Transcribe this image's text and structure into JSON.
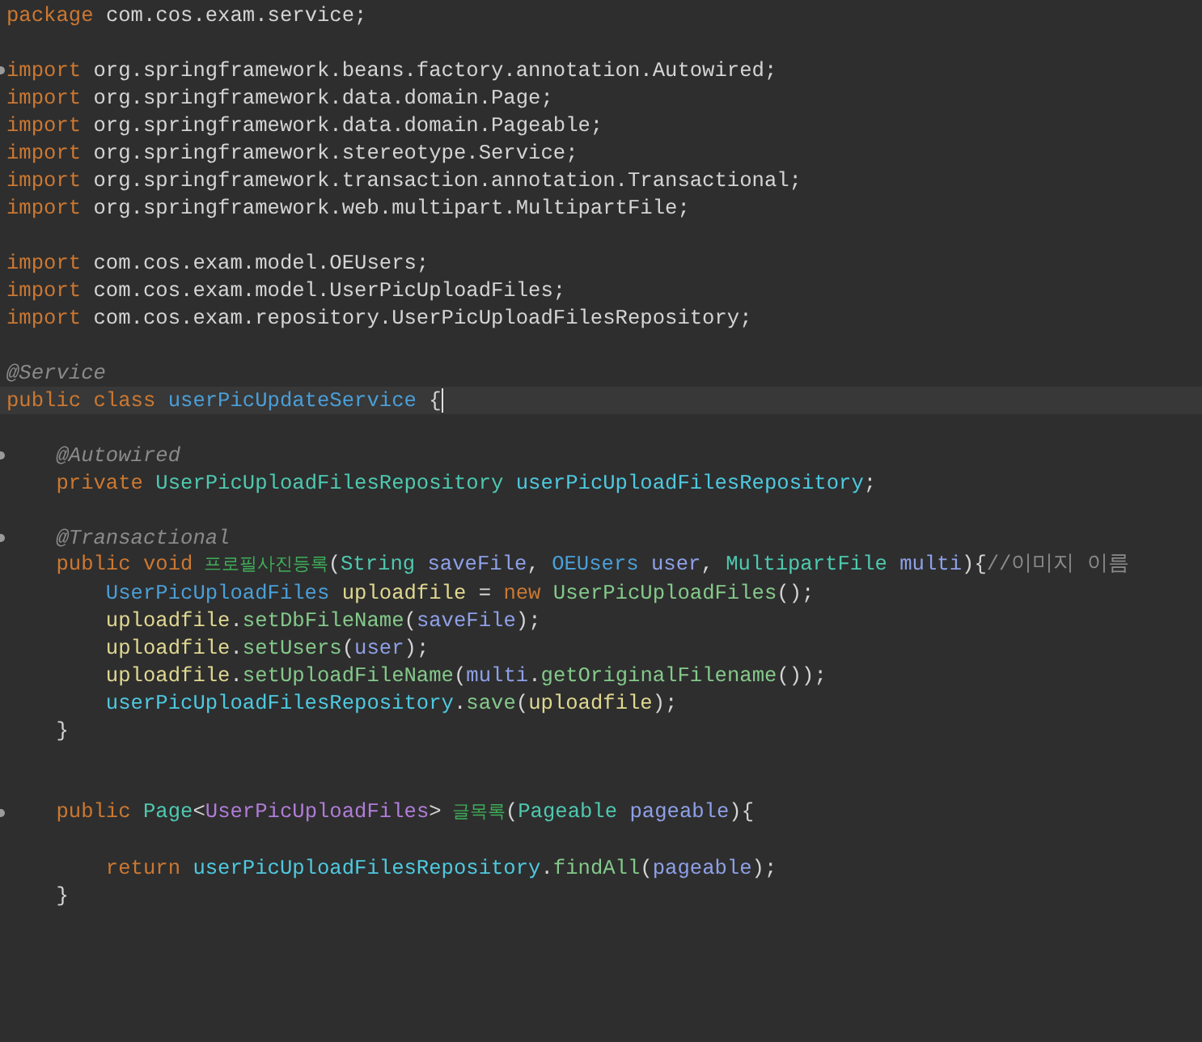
{
  "editor": {
    "lines": [
      {
        "kind": "code",
        "tokens": [
          {
            "kind": "keyword",
            "text": "package"
          },
          {
            "kind": "plain",
            "text": " com.cos.exam.service;"
          }
        ]
      },
      {
        "kind": "blank"
      },
      {
        "kind": "code",
        "marker": true,
        "tokens": [
          {
            "kind": "keyword",
            "text": "import"
          },
          {
            "kind": "plain",
            "text": " org.springframework.beans.factory.annotation.Autowired;"
          }
        ]
      },
      {
        "kind": "code",
        "tokens": [
          {
            "kind": "keyword",
            "text": "import"
          },
          {
            "kind": "plain",
            "text": " org.springframework.data.domain.Page;"
          }
        ]
      },
      {
        "kind": "code",
        "tokens": [
          {
            "kind": "keyword",
            "text": "import"
          },
          {
            "kind": "plain",
            "text": " org.springframework.data.domain.Pageable;"
          }
        ]
      },
      {
        "kind": "code",
        "tokens": [
          {
            "kind": "keyword",
            "text": "import"
          },
          {
            "kind": "plain",
            "text": " org.springframework.stereotype.Service;"
          }
        ]
      },
      {
        "kind": "code",
        "tokens": [
          {
            "kind": "keyword",
            "text": "import"
          },
          {
            "kind": "plain",
            "text": " org.springframework.transaction.annotation.Transactional;"
          }
        ]
      },
      {
        "kind": "code",
        "tokens": [
          {
            "kind": "keyword",
            "text": "import"
          },
          {
            "kind": "plain",
            "text": " org.springframework.web.multipart.MultipartFile;"
          }
        ]
      },
      {
        "kind": "blank"
      },
      {
        "kind": "code",
        "tokens": [
          {
            "kind": "keyword",
            "text": "import"
          },
          {
            "kind": "plain",
            "text": " com.cos.exam.model.OEUsers;"
          }
        ]
      },
      {
        "kind": "code",
        "tokens": [
          {
            "kind": "keyword",
            "text": "import"
          },
          {
            "kind": "plain",
            "text": " com.cos.exam.model.UserPicUploadFiles;"
          }
        ]
      },
      {
        "kind": "code",
        "tokens": [
          {
            "kind": "keyword",
            "text": "import"
          },
          {
            "kind": "plain",
            "text": " com.cos.exam.repository.UserPicUploadFilesRepository;"
          }
        ]
      },
      {
        "kind": "blank"
      },
      {
        "kind": "code",
        "tokens": [
          {
            "kind": "annotation",
            "text": "@Service"
          }
        ]
      },
      {
        "kind": "code",
        "current": true,
        "tokens": [
          {
            "kind": "keyword",
            "text": "public class"
          },
          {
            "kind": "class_name",
            "text": " userPicUpdateService"
          },
          {
            "kind": "plain",
            "text": " {"
          }
        ]
      },
      {
        "kind": "blank"
      },
      {
        "kind": "code",
        "marker": true,
        "tokens": [
          {
            "kind": "annotation",
            "text": "    @Autowired"
          }
        ]
      },
      {
        "kind": "code",
        "tokens": [
          {
            "kind": "keyword",
            "text": "    private"
          },
          {
            "kind": "type",
            "text": " UserPicUploadFilesRepository"
          },
          {
            "kind": "field",
            "text": " userPicUploadFilesRepository"
          },
          {
            "kind": "plain",
            "text": ";"
          }
        ]
      },
      {
        "kind": "blank"
      },
      {
        "kind": "code",
        "marker": true,
        "tokens": [
          {
            "kind": "annotation",
            "text": "    @Transactional"
          }
        ]
      },
      {
        "kind": "code",
        "tokens": [
          {
            "kind": "keyword",
            "text": "    public void"
          },
          {
            "kind": "method_kr",
            "text": " 프로필사진등록"
          },
          {
            "kind": "plain",
            "text": "("
          },
          {
            "kind": "type",
            "text": "String"
          },
          {
            "kind": "param",
            "text": " saveFile"
          },
          {
            "kind": "plain",
            "text": ","
          },
          {
            "kind": "class_name",
            "text": " OEUsers"
          },
          {
            "kind": "param",
            "text": " user"
          },
          {
            "kind": "plain",
            "text": ","
          },
          {
            "kind": "type",
            "text": " MultipartFile"
          },
          {
            "kind": "param",
            "text": " multi"
          },
          {
            "kind": "plain",
            "text": "){"
          },
          {
            "kind": "comment",
            "text": "//이미지 이름"
          }
        ]
      },
      {
        "kind": "code",
        "tokens": [
          {
            "kind": "class_name",
            "text": "        UserPicUploadFiles"
          },
          {
            "kind": "local",
            "text": " uploadfile"
          },
          {
            "kind": "plain",
            "text": " ="
          },
          {
            "kind": "keyword",
            "text": " new"
          },
          {
            "kind": "method",
            "text": " UserPicUploadFiles"
          },
          {
            "kind": "plain",
            "text": "();"
          }
        ]
      },
      {
        "kind": "code",
        "tokens": [
          {
            "kind": "local",
            "text": "        uploadfile"
          },
          {
            "kind": "plain",
            "text": "."
          },
          {
            "kind": "method",
            "text": "setDbFileName"
          },
          {
            "kind": "plain",
            "text": "("
          },
          {
            "kind": "param",
            "text": "saveFile"
          },
          {
            "kind": "plain",
            "text": ");"
          }
        ]
      },
      {
        "kind": "code",
        "tokens": [
          {
            "kind": "local",
            "text": "        uploadfile"
          },
          {
            "kind": "plain",
            "text": "."
          },
          {
            "kind": "method",
            "text": "setUsers"
          },
          {
            "kind": "plain",
            "text": "("
          },
          {
            "kind": "param",
            "text": "user"
          },
          {
            "kind": "plain",
            "text": ");"
          }
        ]
      },
      {
        "kind": "code",
        "tokens": [
          {
            "kind": "local",
            "text": "        uploadfile"
          },
          {
            "kind": "plain",
            "text": "."
          },
          {
            "kind": "method",
            "text": "setUploadFileName"
          },
          {
            "kind": "plain",
            "text": "("
          },
          {
            "kind": "param",
            "text": "multi"
          },
          {
            "kind": "plain",
            "text": "."
          },
          {
            "kind": "method",
            "text": "getOriginalFilename"
          },
          {
            "kind": "plain",
            "text": "());"
          }
        ]
      },
      {
        "kind": "code",
        "tokens": [
          {
            "kind": "field",
            "text": "        userPicUploadFilesRepository"
          },
          {
            "kind": "plain",
            "text": "."
          },
          {
            "kind": "method",
            "text": "save"
          },
          {
            "kind": "plain",
            "text": "("
          },
          {
            "kind": "local",
            "text": "uploadfile"
          },
          {
            "kind": "plain",
            "text": ");"
          }
        ]
      },
      {
        "kind": "code",
        "tokens": [
          {
            "kind": "plain",
            "text": "    }"
          }
        ]
      },
      {
        "kind": "blank"
      },
      {
        "kind": "blank"
      },
      {
        "kind": "code",
        "marker": true,
        "tokens": [
          {
            "kind": "keyword",
            "text": "    public"
          },
          {
            "kind": "type",
            "text": " Page"
          },
          {
            "kind": "plain",
            "text": "<"
          },
          {
            "kind": "generic",
            "text": "UserPicUploadFiles"
          },
          {
            "kind": "plain",
            "text": ">"
          },
          {
            "kind": "method_kr",
            "text": " 글목록"
          },
          {
            "kind": "plain",
            "text": "("
          },
          {
            "kind": "type",
            "text": "Pageable"
          },
          {
            "kind": "param",
            "text": " pageable"
          },
          {
            "kind": "plain",
            "text": "){"
          }
        ]
      },
      {
        "kind": "blank"
      },
      {
        "kind": "code",
        "tokens": [
          {
            "kind": "keyword",
            "text": "        return"
          },
          {
            "kind": "field",
            "text": " userPicUploadFilesRepository"
          },
          {
            "kind": "plain",
            "text": "."
          },
          {
            "kind": "method",
            "text": "findAll"
          },
          {
            "kind": "plain",
            "text": "("
          },
          {
            "kind": "param",
            "text": "pageable"
          },
          {
            "kind": "plain",
            "text": ");"
          }
        ]
      },
      {
        "kind": "code",
        "tokens": [
          {
            "kind": "plain",
            "text": "    }"
          }
        ]
      }
    ]
  }
}
